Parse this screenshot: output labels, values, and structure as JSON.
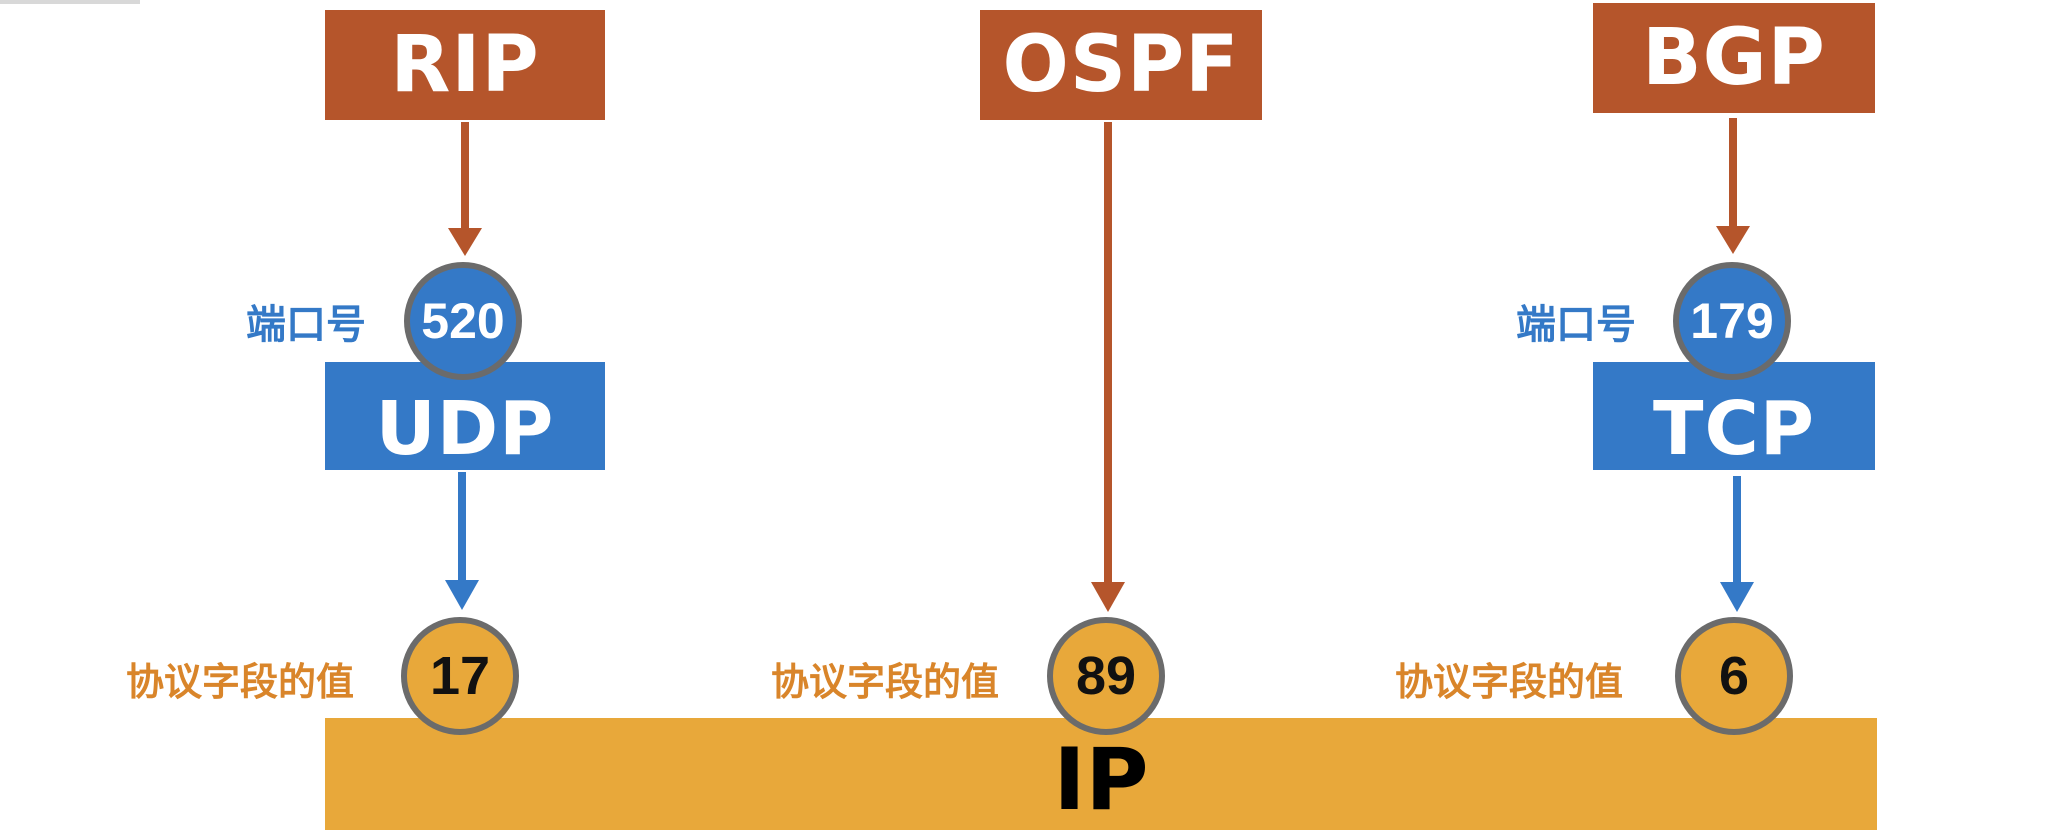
{
  "top_protocols": [
    {
      "name": "RIP"
    },
    {
      "name": "OSPF"
    },
    {
      "name": "BGP"
    }
  ],
  "transport": [
    {
      "name": "UDP",
      "port_label": "端口号",
      "port": "520"
    },
    {
      "name": "TCP",
      "port_label": "端口号",
      "port": "179"
    }
  ],
  "protocol_field": [
    {
      "label": "协议字段的值",
      "value": "17"
    },
    {
      "label": "协议字段的值",
      "value": "89"
    },
    {
      "label": "协议字段的值",
      "value": "6"
    }
  ],
  "network_layer": {
    "name": "IP"
  },
  "colors": {
    "app_box": "#b5552b",
    "transport_box": "#3479c7",
    "ip_bar": "#e8a83a",
    "circle_border": "#6b6b6b",
    "port_text": "#3479c7",
    "field_text": "#d9852a"
  }
}
